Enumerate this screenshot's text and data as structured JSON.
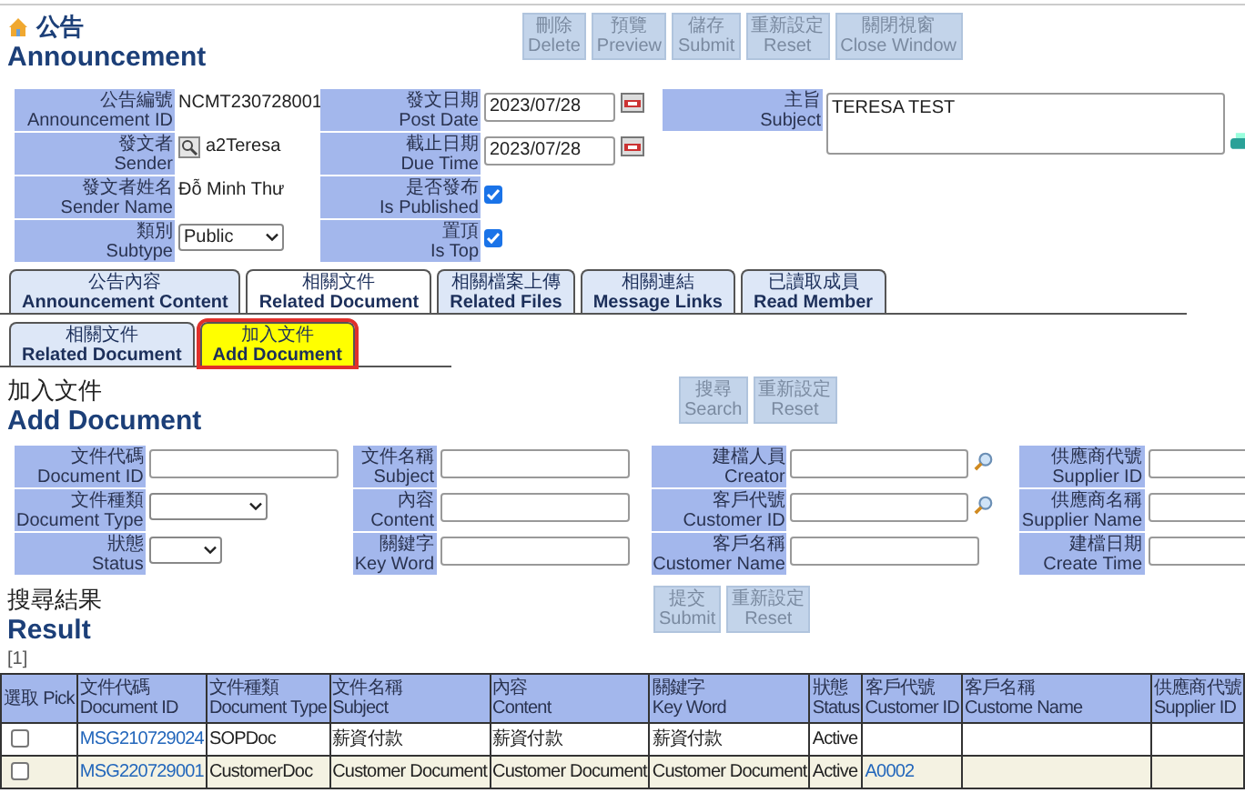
{
  "header": {
    "title_zh": "公告",
    "title_en": "Announcement"
  },
  "toolbar": [
    {
      "zh": "刪除",
      "en": "Delete"
    },
    {
      "zh": "預覽",
      "en": "Preview"
    },
    {
      "zh": "儲存",
      "en": "Submit"
    },
    {
      "zh": "重新設定",
      "en": "Reset"
    },
    {
      "zh": "關閉視窗",
      "en": "Close Window"
    }
  ],
  "announcement_form": [
    [
      {
        "zh": "公告編號",
        "en": "Announcement ID",
        "kind": "text",
        "value": "NCMT230728001"
      },
      {
        "zh": "發文者",
        "en": "Sender",
        "kind": "lookup",
        "value": "a2Teresa"
      },
      {
        "zh": "發文者姓名",
        "en": "Sender Name",
        "kind": "text",
        "value": "Đỗ Minh Thư"
      },
      {
        "zh": "類別",
        "en": "Subtype",
        "kind": "select",
        "value": "Public"
      }
    ],
    [
      {
        "zh": "發文日期",
        "en": "Post Date",
        "kind": "date",
        "value": "2023/07/28"
      },
      {
        "zh": "截止日期",
        "en": "Due Time",
        "kind": "date",
        "value": "2023/07/28"
      },
      {
        "zh": "是否發布",
        "en": "Is Published",
        "kind": "checkbox",
        "checked": true
      },
      {
        "zh": "置頂",
        "en": "Is Top",
        "kind": "checkbox",
        "checked": true
      }
    ],
    [
      {
        "zh": "主旨",
        "en": "Subject",
        "kind": "textarea",
        "value": "TERESA TEST"
      }
    ]
  ],
  "tabs": [
    {
      "zh": "公告內容",
      "en": "Announcement Content",
      "selected": false
    },
    {
      "zh": "相關文件",
      "en": "Related Document",
      "selected": true
    },
    {
      "zh": "相關檔案上傳",
      "en": "Related Files",
      "selected": false
    },
    {
      "zh": "相關連結",
      "en": "Message Links",
      "selected": false
    },
    {
      "zh": "已讀取成員",
      "en": "Read Member",
      "selected": false
    }
  ],
  "subtabs": [
    {
      "zh": "相關文件",
      "en": "Related Document",
      "selected": false
    },
    {
      "zh": "加入文件",
      "en": "Add Document",
      "selected": true
    }
  ],
  "add_document": {
    "title_zh": "加入文件",
    "title_en": "Add Document",
    "buttons": [
      {
        "zh": "搜尋",
        "en": "Search"
      },
      {
        "zh": "重新設定",
        "en": "Reset"
      }
    ],
    "columns": [
      [
        {
          "zh": "文件代碼",
          "en": "Document ID",
          "kind": "input"
        },
        {
          "zh": "文件種類",
          "en": "Document Type",
          "kind": "select"
        },
        {
          "zh": "狀態",
          "en": "Status",
          "kind": "select"
        }
      ],
      [
        {
          "zh": "文件名稱",
          "en": "Subject",
          "kind": "input"
        },
        {
          "zh": "內容",
          "en": "Content",
          "kind": "input"
        },
        {
          "zh": "關鍵字",
          "en": "Key Word",
          "kind": "input"
        }
      ],
      [
        {
          "zh": "建檔人員",
          "en": "Creator",
          "kind": "input",
          "lookup": true
        },
        {
          "zh": "客戶代號",
          "en": "Customer ID",
          "kind": "input",
          "lookup": true
        },
        {
          "zh": "客戶名稱",
          "en": "Customer Name",
          "kind": "input"
        }
      ],
      [
        {
          "zh": "供應商代號",
          "en": "Supplier ID",
          "kind": "input"
        },
        {
          "zh": "供應商名稱",
          "en": "Supplier Name",
          "kind": "input"
        },
        {
          "zh": "建檔日期",
          "en": "Create Time",
          "kind": "input"
        }
      ]
    ]
  },
  "result": {
    "title_zh": "搜尋結果",
    "title_en": "Result",
    "buttons": [
      {
        "zh": "提交",
        "en": "Submit"
      },
      {
        "zh": "重新設定",
        "en": "Reset"
      }
    ],
    "pager": "[1]",
    "table": {
      "pick_header": {
        "zh": "選取",
        "en": "Pick"
      },
      "columns": [
        {
          "zh": "文件代碼",
          "en": "Document ID",
          "kind": "link"
        },
        {
          "zh": "文件種類",
          "en": "Document Type",
          "kind": "text"
        },
        {
          "zh": "文件名稱",
          "en": "Subject",
          "kind": "text"
        },
        {
          "zh": "內容",
          "en": "Content",
          "kind": "text"
        },
        {
          "zh": "關鍵字",
          "en": "Key Word",
          "kind": "text"
        },
        {
          "zh": "狀態",
          "en": "Status",
          "kind": "text"
        },
        {
          "zh": "客戶代號",
          "en": "Customer ID",
          "kind": "link"
        },
        {
          "zh": "客戶名稱",
          "en": "Custome Name",
          "kind": "text"
        },
        {
          "zh": "供應商代號",
          "en": "Supplier ID",
          "kind": "text"
        }
      ],
      "rows": [
        {
          "checked": false,
          "cells": [
            "MSG210729024",
            "SOPDoc",
            "薪資付款",
            "薪資付款",
            "薪資付款",
            "Active",
            null,
            null,
            null
          ]
        },
        {
          "checked": false,
          "cells": [
            "MSG220729001",
            "CustomerDoc",
            "Customer Document",
            "Customer Document",
            "Customer Document",
            "Active",
            "A0002",
            null,
            null
          ]
        }
      ]
    }
  }
}
